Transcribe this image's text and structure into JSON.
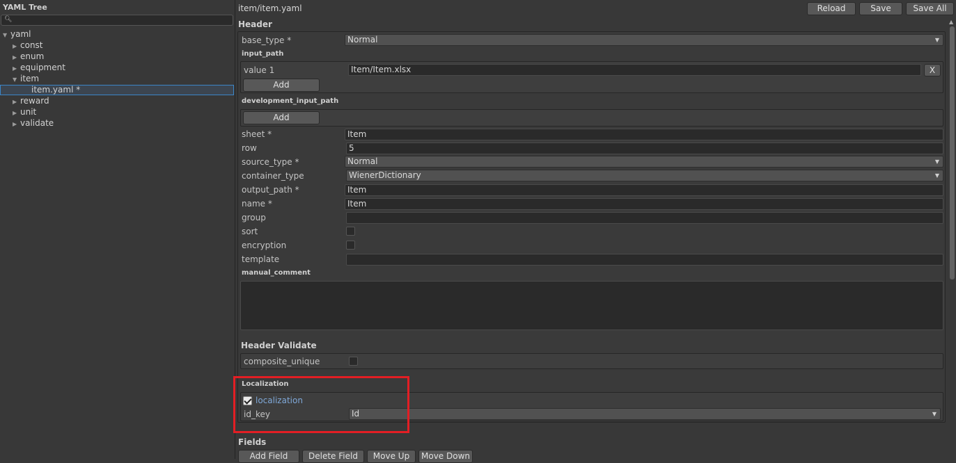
{
  "tree": {
    "title": "YAML Tree",
    "search_placeholder": "",
    "items": [
      {
        "label": "yaml",
        "arrow": "▼"
      },
      {
        "label": "const",
        "arrow": "▶"
      },
      {
        "label": "enum",
        "arrow": "▶"
      },
      {
        "label": "equipment",
        "arrow": "▶"
      },
      {
        "label": "item",
        "arrow": "▼"
      },
      {
        "label": "item.yaml *",
        "arrow": ""
      },
      {
        "label": "reward",
        "arrow": "▶"
      },
      {
        "label": "unit",
        "arrow": "▶"
      },
      {
        "label": "validate",
        "arrow": "▶"
      }
    ]
  },
  "main": {
    "title": "item/item.yaml",
    "buttons": {
      "reload": "Reload",
      "save": "Save",
      "save_all": "Save All"
    },
    "header": {
      "title": "Header",
      "base_type": {
        "label": "base_type *",
        "value": "Normal"
      },
      "input_path": {
        "title": "input_path",
        "item_label": "value 1",
        "item_value": "Item/Item.xlsx",
        "remove_label": "X",
        "add_label": "Add"
      },
      "development_input_path": {
        "title": "development_input_path",
        "add_label": "Add"
      },
      "sheet": {
        "label": "sheet *",
        "value": "Item"
      },
      "row": {
        "label": "row",
        "value": "5"
      },
      "source_type": {
        "label": "source_type *",
        "value": "Normal"
      },
      "container_type": {
        "label": "container_type",
        "value": "WienerDictionary"
      },
      "output_path": {
        "label": "output_path *",
        "value": "Item"
      },
      "name": {
        "label": "name *",
        "value": "Item"
      },
      "group": {
        "label": "group",
        "value": ""
      },
      "sort": {
        "label": "sort",
        "checked": false
      },
      "encryption": {
        "label": "encryption",
        "checked": false
      },
      "template": {
        "label": "template",
        "value": ""
      },
      "manual_comment": {
        "title": "manual_comment",
        "value": ""
      }
    },
    "header_validate": {
      "title": "Header Validate",
      "composite_unique": {
        "label": "composite_unique",
        "checked": false
      }
    },
    "localization": {
      "title": "Localization",
      "toggle": {
        "label": "localization",
        "checked": true
      },
      "id_key": {
        "label": "id_key",
        "value": "Id"
      }
    },
    "fields": {
      "title": "Fields",
      "buttons": {
        "add": "Add Field",
        "delete": "Delete Field",
        "move_up": "Move Up",
        "move_down": "Move Down"
      }
    }
  },
  "colors": {
    "background": "#383838",
    "field": "#2a2a2a",
    "accent": "#3b86c8",
    "highlight": "#e31e24",
    "link": "#7fa8d8"
  }
}
